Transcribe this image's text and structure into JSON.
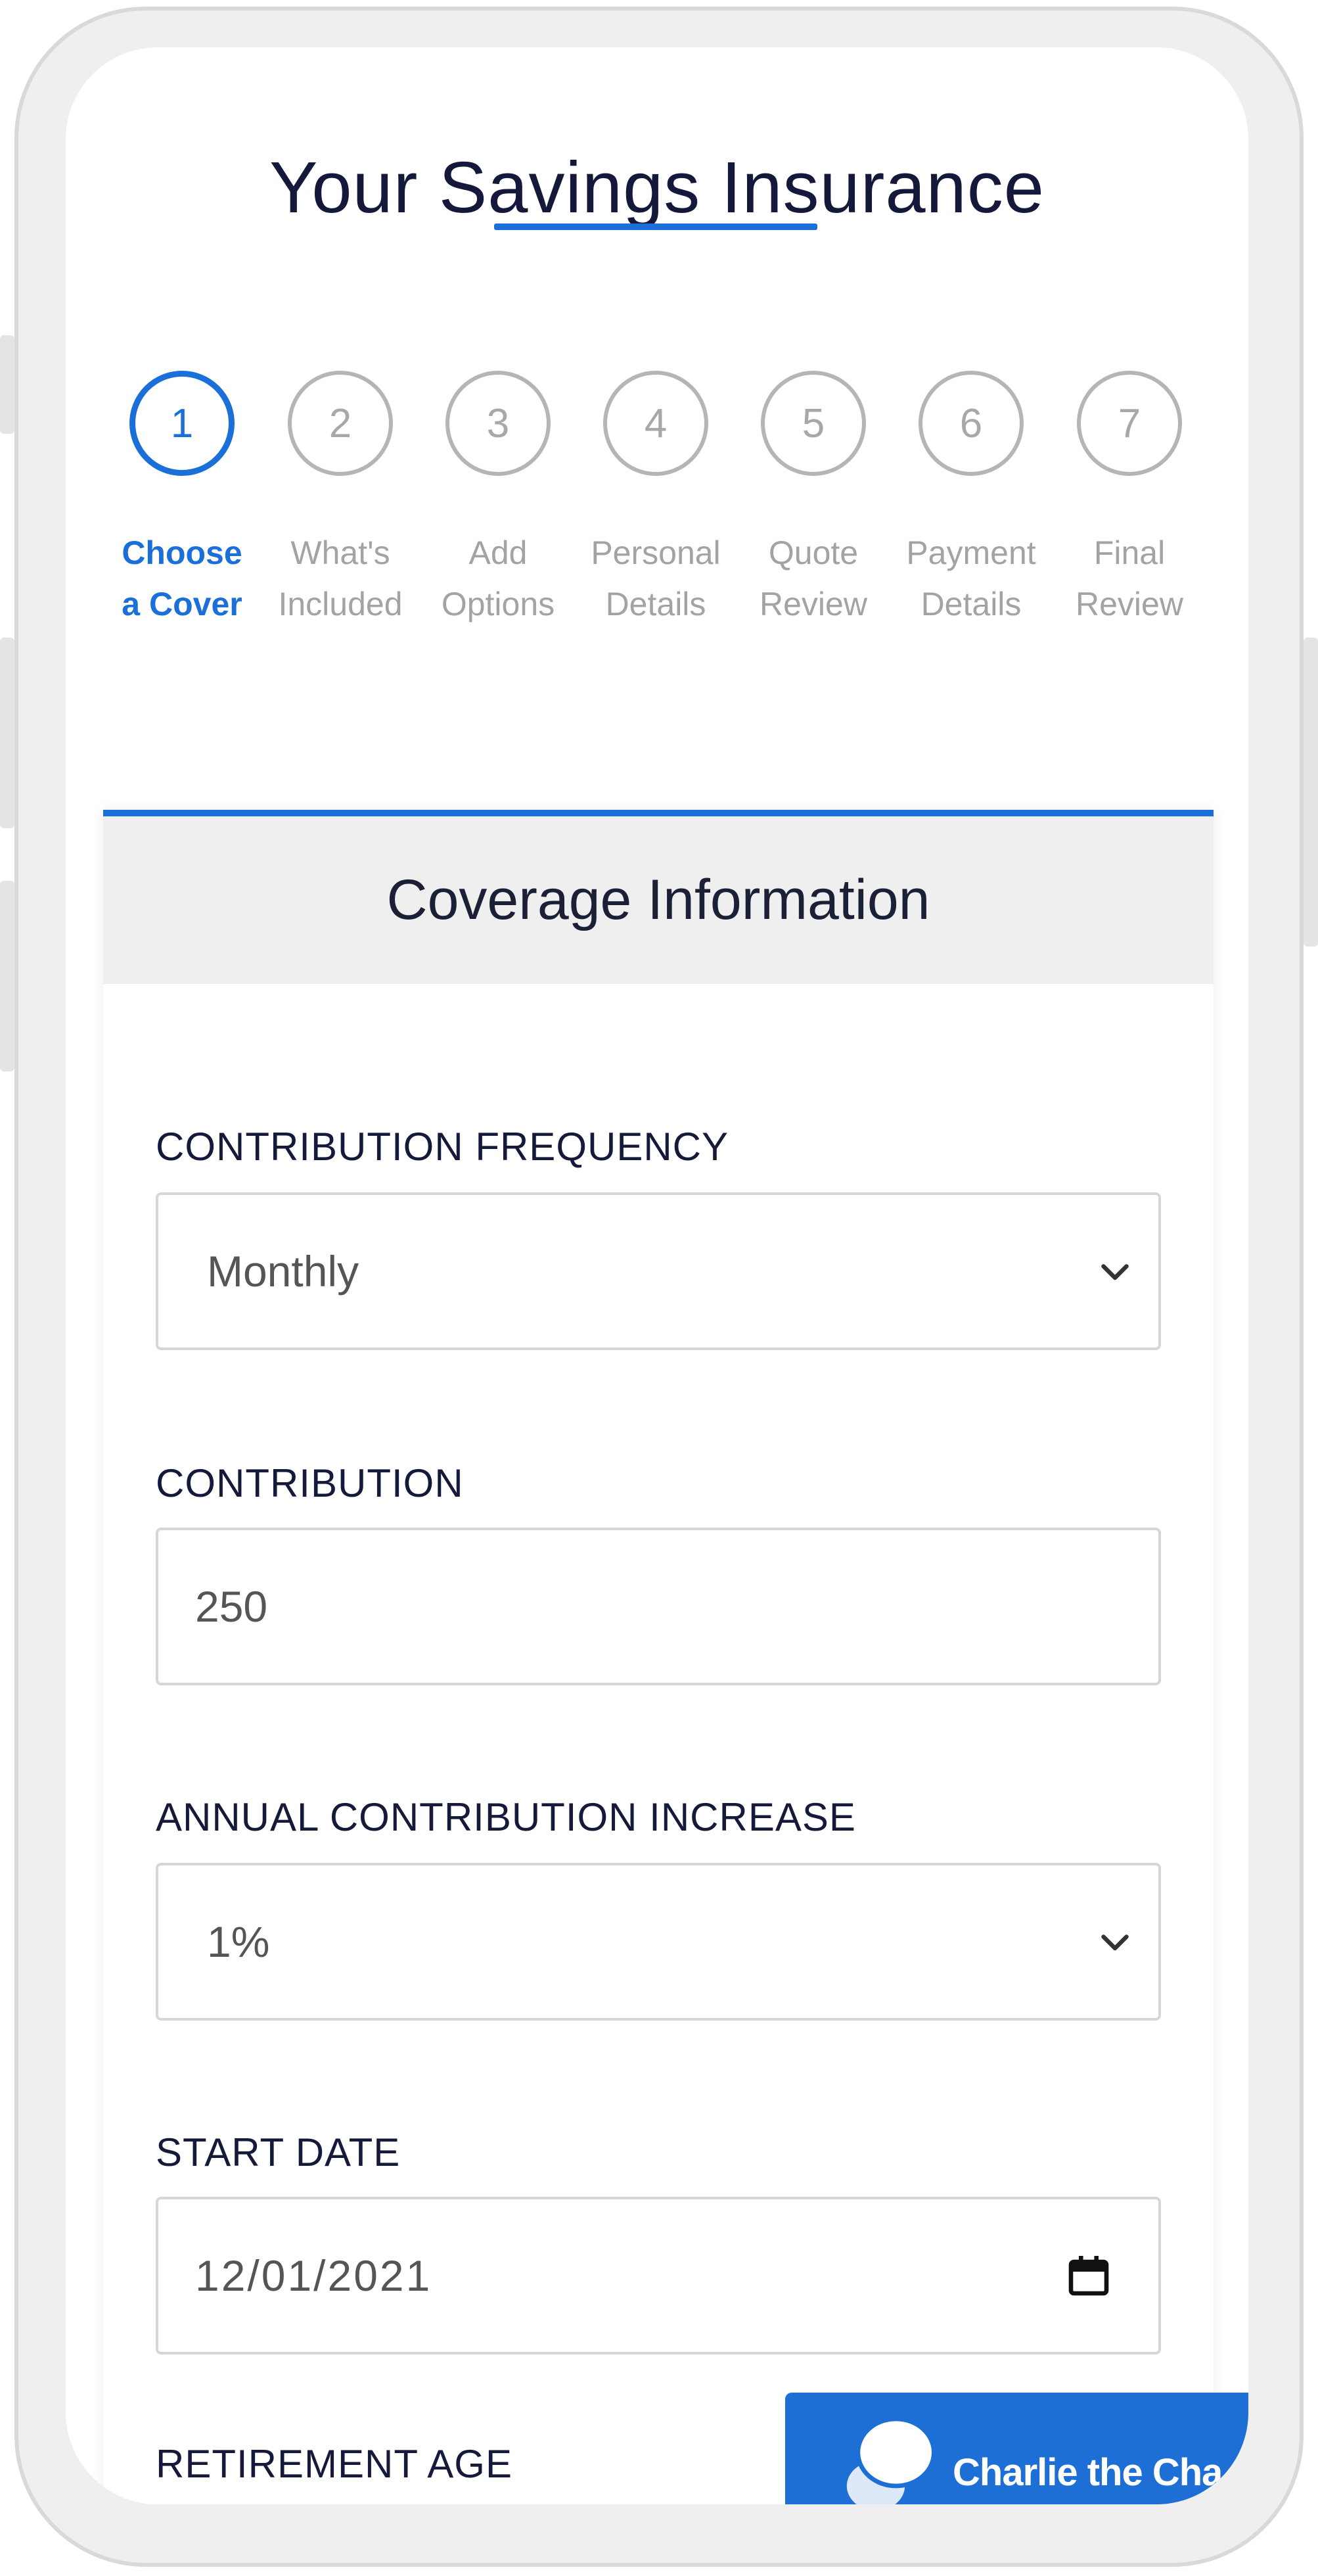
{
  "page": {
    "title": "Your Savings Insurance"
  },
  "stepper": {
    "steps": [
      {
        "number": "1",
        "line1": "Choose",
        "line2": "a Cover",
        "active": true
      },
      {
        "number": "2",
        "line1": "What's",
        "line2": "Included",
        "active": false
      },
      {
        "number": "3",
        "line1": "Add",
        "line2": "Options",
        "active": false
      },
      {
        "number": "4",
        "line1": "Personal",
        "line2": "Details",
        "active": false
      },
      {
        "number": "5",
        "line1": "Quote",
        "line2": "Review",
        "active": false
      },
      {
        "number": "6",
        "line1": "Payment",
        "line2": "Details",
        "active": false
      },
      {
        "number": "7",
        "line1": "Final",
        "line2": "Review",
        "active": false
      }
    ]
  },
  "card": {
    "header": "Coverage Information",
    "fields": {
      "frequency": {
        "label": "CONTRIBUTION FREQUENCY",
        "value": "Monthly"
      },
      "contribution": {
        "label": "CONTRIBUTION",
        "value": "250"
      },
      "increase": {
        "label": "ANNUAL CONTRIBUTION INCREASE",
        "value": "1%"
      },
      "start_date": {
        "label": "START DATE",
        "value": "12/01/2021"
      },
      "retirement_age": {
        "label": "RETIREMENT AGE"
      }
    }
  },
  "chat": {
    "label": "Charlie the Cha"
  },
  "icons": {
    "select_arrow": "chevron-down-icon",
    "date_picker": "calendar-icon",
    "chat": "chat-bubble-icon"
  },
  "colors": {
    "accent": "#1b6fd8",
    "title_text": "#14183a",
    "inactive_step": "#a8a8a8",
    "header_bg": "#efefef",
    "chat_bg": "#1d6fd6"
  }
}
